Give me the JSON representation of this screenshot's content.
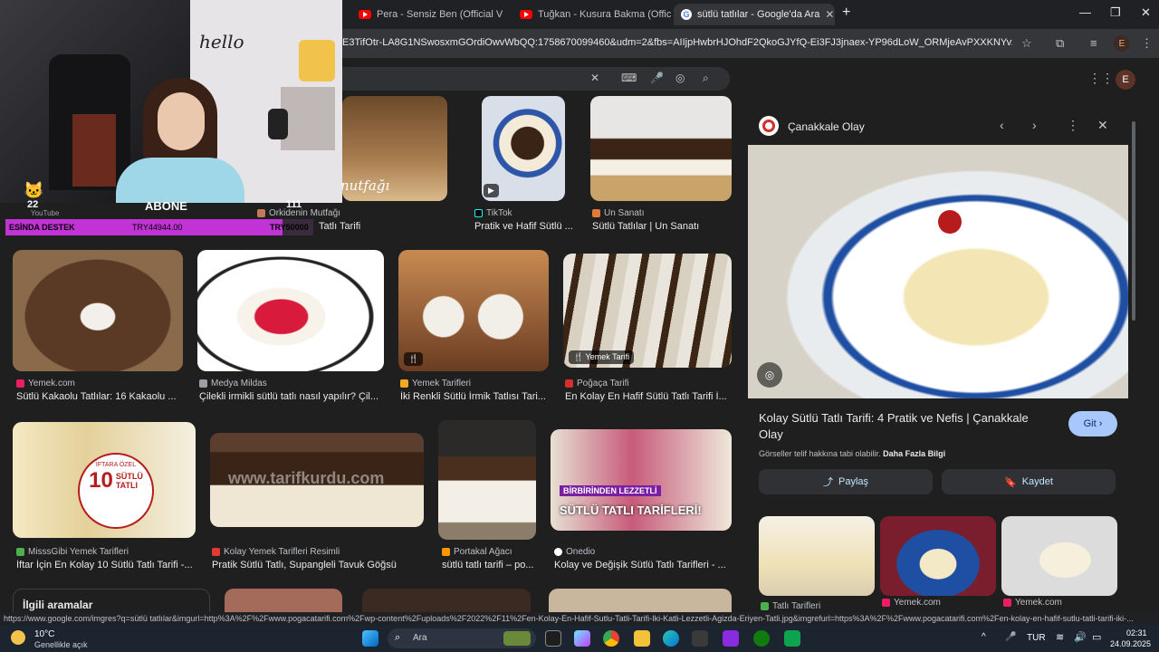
{
  "tabs": [
    {
      "title": "Pera - Sensiz Ben (Official V",
      "icon": "youtube-icon"
    },
    {
      "title": "Tuğkan - Kusura Bakma (Officia",
      "icon": "youtube-icon"
    },
    {
      "title": "sütlü tatlılar - Google'da Ara",
      "icon": "google-icon"
    }
  ],
  "new_tab": "+",
  "address": "E3TifOtr-LA8G1NSwosxmGOrdiOwvWbQQ:1758670099460&udm=2&fbs=AIIjpHwbrHJOhdF2QkoGJYfQ-Ei3FJ3jnaex-YP96dLoW_ORMjeAvPXXKNYvzmhHNm...",
  "profile_letter": "E",
  "top_row": [
    {
      "source": "Orkidenin Mutfağı",
      "title": "Tatlı Tarifi"
    },
    {
      "source": "TikTok",
      "title": "Pratik ve Hafif Sütlü ..."
    },
    {
      "source": "Un Sanatı",
      "title": "Sütlü Tatlılar | Un Sanatı"
    }
  ],
  "row2": [
    {
      "source": "Yemek.com",
      "title": "Sütlü Kakaolu Tatlılar: 16 Kakaolu ..."
    },
    {
      "source": "Medya Mildas",
      "title": "Çilekli irmikli sütlü tatlı nasıl yapılır? Çil..."
    },
    {
      "source": "Yemek Tarifleri",
      "title": "İki Renkli Sütlü İrmik Tatlısı Tari..."
    },
    {
      "source": "Poğaça Tarifi",
      "title": "En Kolay En Hafif Sütlü Tatlı Tarifi İ...",
      "badge": "Yemek Tarifi"
    }
  ],
  "row3": [
    {
      "source": "MisssGibi Yemek Tarifleri",
      "title": "İftar İçin En Kolay 10 Sütlü Tatlı Tarifi -..."
    },
    {
      "source": "Kolay Yemek Tarifleri Resimli",
      "title": "Pratik Sütlü Tatlı, Supangleli Tavuk Göğsü"
    },
    {
      "source": "Portakal Ağacı",
      "title": "sütlü tatlı tarifi – po..."
    },
    {
      "source": "Onedio",
      "title": "Kolay ve Değişik Sütlü Tatlı Tarifleri - ..."
    }
  ],
  "image_texts": {
    "iftar_small": "İFTARA ÖZEL",
    "iftar_big": "10",
    "iftar_line1": "SÜTLÜ",
    "iftar_line2": "TATLI",
    "onedio_top": "BİRBİRİNDEN LEZZETLİ",
    "onedio_bottom": "SÜTLÜ TATLI TARİFLERİ!",
    "watermark": "www.tarifkurdu.com",
    "nutfagi": "nutfağı"
  },
  "related_heading": "İlgili aramalar",
  "panel": {
    "source": "Çanakkale Olay",
    "title": "Kolay Sütlü Tatlı Tarifi: 4 Pratik ve Nefis | Çanakkale Olay",
    "go_label": "Git",
    "copyright_text": "Görseller telif hakkına tabi olabilir.",
    "more_info": "Daha Fazla Bilgi",
    "share_label": "Paylaş",
    "save_label": "Kaydet",
    "related": [
      {
        "source": "Tatlı Tarifleri"
      },
      {
        "source": "Yemek.com"
      },
      {
        "source": "Yemek.com"
      }
    ]
  },
  "overlay": {
    "hello": "hello",
    "sub_count": "22",
    "abone": "ABONE",
    "abone_count": "111",
    "youtube_label": "YouTube",
    "donation_label": "ESİNDA DESTEK",
    "donation_amount": "TRY44944.00",
    "donation_goal": "TRY50000"
  },
  "status_url": "https://www.google.com/imgres?q=sütlü tatlılar&imgurl=http%3A%2F%2Fwww.pogacatarifi.com%2Fwp-content%2Fuploads%2F2022%2F11%2Fen-Kolay-En-Hafif-Sutlu-Tatli-Tarifi-Iki-Katli-Lezzetli-Agizda-Eriyen-Tatli.jpg&imgrefurl=https%3A%2F%2Fwww.pogacatarifi.com%2Fen-kolay-en-hafif-sutlu-tatli-tarifi-iki-...",
  "taskbar": {
    "temperature": "10°C",
    "weather": "Genellikle açık",
    "search_placeholder": "Ara",
    "language": "TUR",
    "time": "02:31",
    "date": "24.09.2025"
  },
  "colors": {
    "accent": "#8ab4f8",
    "donation_bar": "#c233d6",
    "go_button": "#a8c7fa"
  }
}
